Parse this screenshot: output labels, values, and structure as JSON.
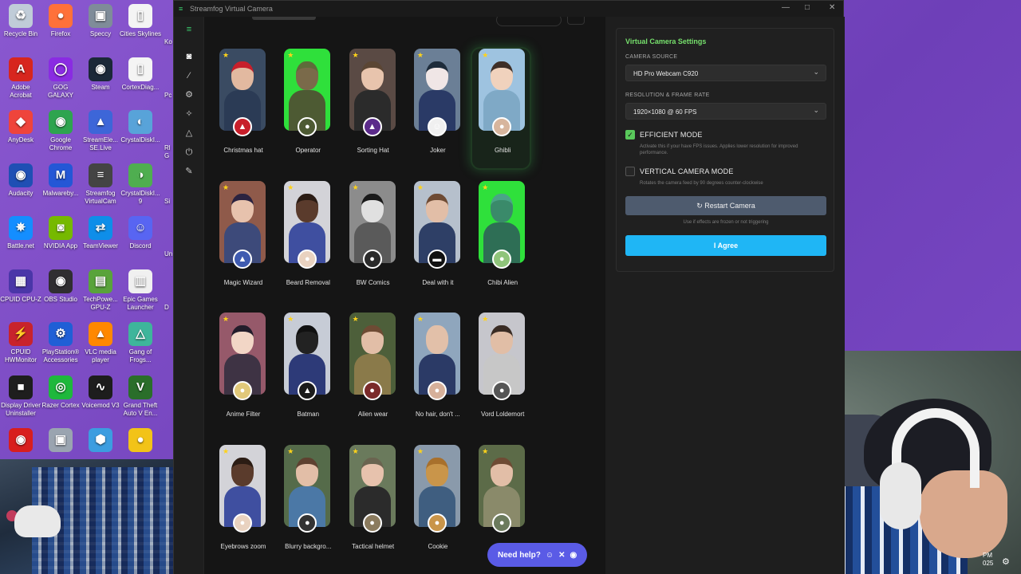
{
  "window": {
    "title": "Streamfog Virtual Camera",
    "controls": [
      "—",
      "□",
      "✕"
    ]
  },
  "desktop_icons": [
    {
      "label": "Recycle Bin",
      "glyph": "♻",
      "color": "#c0ccd8",
      "icon": "recycle-bin-icon"
    },
    {
      "label": "Firefox",
      "glyph": "●",
      "color": "#ff7139",
      "icon": "firefox-icon"
    },
    {
      "label": "Speccy",
      "glyph": "▣",
      "color": "#7f8c99",
      "icon": "speccy-icon"
    },
    {
      "label": "Cities Skylines",
      "glyph": "▯",
      "color": "#f4f4f4",
      "icon": "file-icon"
    },
    {
      "label": "Adobe Acrobat",
      "glyph": "A",
      "color": "#d7261e",
      "icon": "acrobat-icon"
    },
    {
      "label": "GOG GALAXY",
      "glyph": "◯",
      "color": "#8a2be2",
      "icon": "gog-icon"
    },
    {
      "label": "Steam",
      "glyph": "◉",
      "color": "#1b2838",
      "icon": "steam-icon"
    },
    {
      "label": "CortexDiag...",
      "glyph": "▯",
      "color": "#f4f4f4",
      "icon": "file-icon"
    },
    {
      "label": "AnyDesk",
      "glyph": "◆",
      "color": "#ef443b",
      "icon": "anydesk-icon"
    },
    {
      "label": "Google Chrome",
      "glyph": "◉",
      "color": "#2ea44f",
      "icon": "chrome-icon"
    },
    {
      "label": "StreamEle... SE.Live",
      "glyph": "▲",
      "color": "#3d66d8",
      "icon": "streamelements-icon"
    },
    {
      "label": "CrystalDiskI...",
      "glyph": "◐",
      "color": "#58a3d9",
      "icon": "crystaldisk-icon"
    },
    {
      "label": "Audacity",
      "glyph": "◉",
      "color": "#1f4fb4",
      "icon": "audacity-icon"
    },
    {
      "label": "Malwareby...",
      "glyph": "M",
      "color": "#2457d6",
      "icon": "malwarebytes-icon"
    },
    {
      "label": "Streamfog VirtualCam",
      "glyph": "≡",
      "color": "#444444",
      "icon": "streamfog-icon"
    },
    {
      "label": "CrystalDiskI... 9",
      "glyph": "◑",
      "color": "#4fae50",
      "icon": "crystaldisk-icon"
    },
    {
      "label": "Battle.net",
      "glyph": "✵",
      "color": "#148eff",
      "icon": "battlenet-icon"
    },
    {
      "label": "NVIDIA App",
      "glyph": "◙",
      "color": "#76b900",
      "icon": "nvidia-icon"
    },
    {
      "label": "TeamViewer",
      "glyph": "⇄",
      "color": "#0e8ee9",
      "icon": "teamviewer-icon"
    },
    {
      "label": "Discord",
      "glyph": "☺",
      "color": "#5865f2",
      "icon": "discord-icon"
    },
    {
      "label": "CPUID CPU-Z",
      "glyph": "▦",
      "color": "#4a36a8",
      "icon": "cpuz-icon"
    },
    {
      "label": "OBS Studio",
      "glyph": "◉",
      "color": "#302e31",
      "icon": "obs-icon"
    },
    {
      "label": "TechPowe... GPU-Z",
      "glyph": "▤",
      "color": "#59a33b",
      "icon": "gpuz-icon"
    },
    {
      "label": "Epic Games Launcher",
      "glyph": "▥",
      "color": "#f0f0f0",
      "icon": "epic-icon"
    },
    {
      "label": "CPUID HWMonitor",
      "glyph": "⚡",
      "color": "#c8232c",
      "icon": "hwmonitor-icon"
    },
    {
      "label": "PlayStation® Accessories",
      "glyph": "⚙",
      "color": "#1f5fd6",
      "icon": "playstation-icon"
    },
    {
      "label": "VLC media player",
      "glyph": "▲",
      "color": "#ff8800",
      "icon": "vlc-icon"
    },
    {
      "label": "Gang of Frogs...",
      "glyph": "△",
      "color": "#3eb59b",
      "icon": "game-icon"
    },
    {
      "label": "Display Driver Uninstaller",
      "glyph": "■",
      "color": "#1e1e1e",
      "icon": "ddu-icon"
    },
    {
      "label": "Razer Cortex",
      "glyph": "◎",
      "color": "#1eb83c",
      "icon": "razer-icon"
    },
    {
      "label": "Voicemod V3",
      "glyph": "∿",
      "color": "#1d1d1d",
      "icon": "voicemod-icon"
    },
    {
      "label": "Grand Theft Auto V En...",
      "glyph": "V",
      "color": "#2a6e2a",
      "icon": "gta-icon"
    },
    {
      "label": "",
      "glyph": "◉",
      "color": "#d81e1e",
      "icon": "ea-icon"
    },
    {
      "label": "",
      "glyph": "▣",
      "color": "#9aa4b0",
      "icon": "app-icon"
    },
    {
      "label": "",
      "glyph": "⬢",
      "color": "#3c9de0",
      "icon": "app-icon"
    },
    {
      "label": "",
      "glyph": "●",
      "color": "#f2c318",
      "icon": "duck-icon"
    }
  ],
  "desktop_partial": [
    "Ko",
    "Pc",
    "Rl G",
    "Si",
    "Un",
    "D"
  ],
  "taskbar": {
    "time_fragment": "PM",
    "date_fragment": "025"
  },
  "sidebar_icons": [
    "camera-icon",
    "magic-wand-icon",
    "settings-icon",
    "sparkle-icon",
    "warning-icon",
    "plug-icon",
    "tools-icon"
  ],
  "filters": [
    {
      "name": "Christmas hat",
      "bg": "#3a4b62",
      "skin": "#e2b9a0",
      "top": "#c71f2b",
      "body": "#2b3b55",
      "badge": "#c71f2b",
      "badge_glyph": "▲"
    },
    {
      "name": "Operator",
      "bg": "#2fe03b",
      "skin": "#7a6a4a",
      "top": "#5e6b3a",
      "body": "#4d5a33",
      "badge": "#4d5a33",
      "badge_glyph": "●"
    },
    {
      "name": "Sorting Hat",
      "bg": "#5a4a44",
      "skin": "#e8c4ad",
      "top": "#5b4634",
      "body": "#2b2b2b",
      "badge": "#5b2a8a",
      "badge_glyph": "▲"
    },
    {
      "name": "Joker",
      "bg": "#6b7f96",
      "skin": "#f0e6e6",
      "top": "#1e2c3b",
      "body": "#2a3a66",
      "badge": "#f0f0f0",
      "badge_glyph": "☺"
    },
    {
      "name": "Ghibli",
      "bg": "#9ec3e0",
      "skin": "#f0d2bd",
      "top": "#3e2e27",
      "body": "#7fa9c6",
      "badge": "#d7b59d",
      "badge_glyph": "●"
    },
    {
      "name": "Magic Wizard",
      "bg": "#8f5a4a",
      "skin": "#e7c2ad",
      "top": "#2b2340",
      "body": "#3d4a7a",
      "badge": "#3f5bb0",
      "badge_glyph": "▲"
    },
    {
      "name": "Beard Removal",
      "bg": "#d3d3d8",
      "skin": "#5a3b2c",
      "top": "#2b1c14",
      "body": "#3f4fa0",
      "badge": "#e9d2c0",
      "badge_glyph": "●"
    },
    {
      "name": "BW Comics",
      "bg": "#8c8c8c",
      "skin": "#e0e0e0",
      "top": "#1a1a1a",
      "body": "#5a5a5a",
      "badge": "#2a2a2a",
      "badge_glyph": "●"
    },
    {
      "name": "Deal with it",
      "bg": "#b6c0cc",
      "skin": "#e2bea7",
      "top": "#6e4b34",
      "body": "#2e3f66",
      "badge": "#111111",
      "badge_glyph": "▬"
    },
    {
      "name": "Chibi Alien",
      "bg": "#2fe03b",
      "skin": "#3a8a6a",
      "top": "#4aa487",
      "body": "#2e6e55",
      "badge": "#8fc47a",
      "badge_glyph": "●"
    },
    {
      "name": "Anime Filter",
      "bg": "#96596a",
      "skin": "#f2d6c6",
      "top": "#231d2b",
      "body": "#3e3344",
      "badge": "#e1c87a",
      "badge_glyph": "●"
    },
    {
      "name": "Batman",
      "bg": "#c7ccd6",
      "skin": "#222222",
      "top": "#111111",
      "body": "#2d3a78",
      "badge": "#1b1b1b",
      "badge_glyph": "▲"
    },
    {
      "name": "Alien wear",
      "bg": "#4d5f3a",
      "skin": "#e2bea7",
      "top": "#6e4b34",
      "body": "#8a7a4a",
      "badge": "#7a2a2a",
      "badge_glyph": "●"
    },
    {
      "name": "No hair, don't ...",
      "bg": "#8fa6bd",
      "skin": "#e2c0a9",
      "top": "#e2c0a9",
      "body": "#2b3a66",
      "badge": "#d6b09a",
      "badge_glyph": "●"
    },
    {
      "name": "Vord Loldemort",
      "bg": "#c6c6cc",
      "skin": "#e1bea6",
      "top": "#3a2c24",
      "body": "#c7c7c7",
      "badge": "#555555",
      "badge_glyph": "●"
    },
    {
      "name": "Eyebrows zoom",
      "bg": "#d3d3d8",
      "skin": "#5a3b2c",
      "top": "#2b1c14",
      "body": "#3f4fa0",
      "badge": "#e9d2c0",
      "badge_glyph": "●"
    },
    {
      "name": "Blurry backgro...",
      "bg": "#556b4a",
      "skin": "#e2bea7",
      "top": "#5e4130",
      "body": "#4b78a6",
      "badge": "#333333",
      "badge_glyph": "●"
    },
    {
      "name": "Tactical helmet",
      "bg": "#6a7a5c",
      "skin": "#e7c2ad",
      "top": "#6a6450",
      "body": "#2b2b2b",
      "badge": "#8b7b5e",
      "badge_glyph": "●"
    },
    {
      "name": "Cookie",
      "bg": "#8a9aab",
      "skin": "#c9954a",
      "top": "#a8702c",
      "body": "#3f5e80",
      "badge": "#c9954a",
      "badge_glyph": "●"
    },
    {
      "name": "",
      "bg": "#5c6b48",
      "skin": "#e2bea7",
      "top": "#6e4b34",
      "body": "#8a8a6a",
      "badge": "#6b7a5c",
      "badge_glyph": "●"
    }
  ],
  "selected_filter": "Ghibli",
  "help": {
    "label": "Need help?",
    "icons": [
      "☺",
      "✕",
      "◉"
    ]
  },
  "settings": {
    "title": "Virtual Camera Settings",
    "camera_source_label": "CAMERA SOURCE",
    "camera_source_value": "HD Pro Webcam C920",
    "resolution_label": "RESOLUTION & FRAME RATE",
    "resolution_value": "1920×1080 @ 60 FPS",
    "efficient_mode": {
      "label": "EFFICIENT MODE",
      "checked": true,
      "description": "Activate this if your have FPS issues. Applies lower resolution for improved performance."
    },
    "vertical_mode": {
      "label": "VERTICAL CAMERA MODE",
      "checked": false,
      "description": "Rotates the camera feed by 90 degrees counter-clockwise"
    },
    "restart_label": "Restart Camera",
    "restart_note": "Use if effects are frozen or not triggering",
    "agree_label": "I Agree"
  },
  "colors": {
    "accent_green": "#76e06c",
    "agree_blue": "#1fb6f5",
    "help_purple": "#5a5be6",
    "restart": "#4e5b6e"
  }
}
